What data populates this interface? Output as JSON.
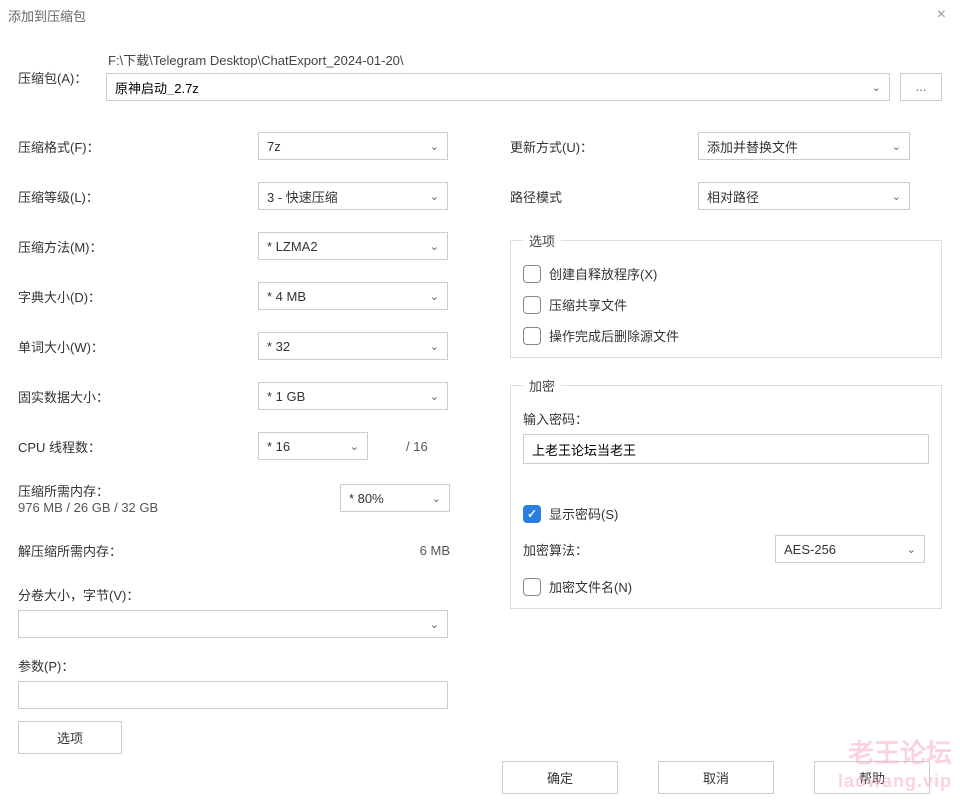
{
  "window": {
    "title": "添加到压缩包"
  },
  "archive": {
    "label": "压缩包(A)：",
    "path": "F:\\下载\\Telegram Desktop\\ChatExport_2024-01-20\\",
    "filename": "原神启动_2.7z",
    "browse": "..."
  },
  "left": {
    "format": {
      "label": "压缩格式(F)：",
      "value": "7z"
    },
    "level": {
      "label": "压缩等级(L)：",
      "value": "3 - 快速压缩"
    },
    "method": {
      "label": "压缩方法(M)：",
      "value": "* LZMA2"
    },
    "dict": {
      "label": "字典大小(D)：",
      "value": "* 4 MB"
    },
    "word": {
      "label": "单词大小(W)：",
      "value": "* 32"
    },
    "solid": {
      "label": "固实数据大小：",
      "value": "* 1 GB"
    },
    "threads": {
      "label": "CPU 线程数：",
      "value": "* 16",
      "suffix": "/ 16"
    },
    "memcomp": {
      "label": "压缩所需内存：",
      "value": "976 MB / 26 GB / 32 GB",
      "pct": "* 80%"
    },
    "memdecomp": {
      "label": "解压缩所需内存：",
      "value": "6 MB"
    },
    "volume": {
      "label": "分卷大小，字节(V)：",
      "value": ""
    },
    "params": {
      "label": "参数(P)：",
      "value": ""
    },
    "options_btn": "选项"
  },
  "right": {
    "update": {
      "label": "更新方式(U)：",
      "value": "添加并替换文件"
    },
    "pathmode": {
      "label": "路径模式",
      "value": "相对路径"
    },
    "options_legend": "选项",
    "opt_sfx": "创建自释放程序(X)",
    "opt_shared": "压缩共享文件",
    "opt_delete": "操作完成后删除源文件",
    "encrypt_legend": "加密",
    "pw_label": "输入密码：",
    "pw_value": "上老王论坛当老王",
    "show_pw": "显示密码(S)",
    "algo_label": "加密算法：",
    "algo_value": "AES-256",
    "encrypt_names": "加密文件名(N)"
  },
  "buttons": {
    "ok": "确定",
    "cancel": "取消",
    "help": "帮助"
  },
  "watermark": {
    "cn": "老王论坛",
    "en": "laowang.vip"
  }
}
